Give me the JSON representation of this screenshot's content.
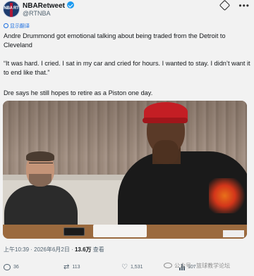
{
  "header": {
    "display_name": "NBARetweet",
    "handle": "@RTNBA",
    "avatar_text": "NBA RT",
    "more_label": "•••"
  },
  "translate_label": "显示翻译",
  "tweet": {
    "paragraph1": "Andre Drummond got emotional talking about being traded from the Detroit to Cleveland",
    "paragraph2": "“It was hard. I cried. I sat in my car and cried for hours. I wanted to stay. I didn’t want it to end like that.”",
    "paragraph3": "Dre says he still hopes to retire as a Piston one day."
  },
  "meta": {
    "time": "上午10:39",
    "date": "2026年6月2日",
    "views_count": "13.6万",
    "views_label": "查看"
  },
  "actions": {
    "replies": "36",
    "retweets": "113",
    "likes": "1,531",
    "views": "107"
  },
  "watermark": "公众号 · 篮球教学论坛",
  "colors": {
    "link_blue": "#1d6fe0",
    "verified_blue": "#1d9bf0",
    "cap_red": "#c41e24",
    "text_gray": "#536471"
  }
}
